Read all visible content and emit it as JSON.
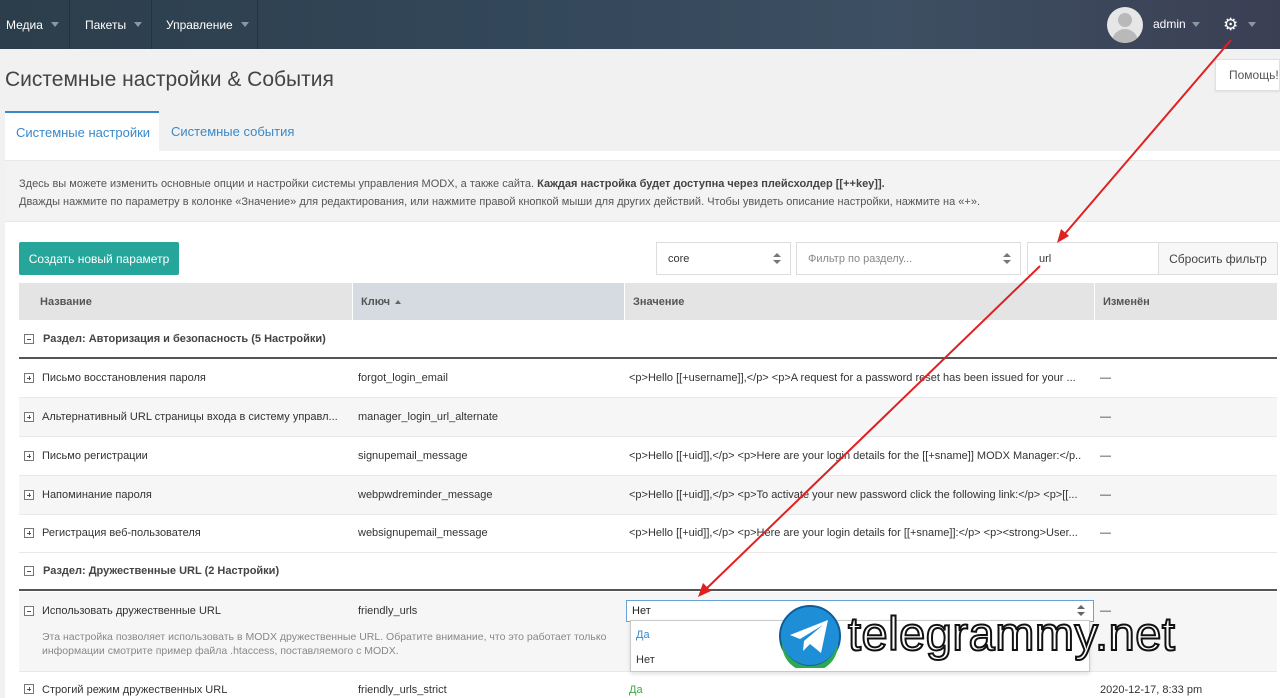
{
  "topnav": {
    "items": [
      {
        "label": "Медиа"
      },
      {
        "label": "Пакеты"
      },
      {
        "label": "Управление"
      }
    ],
    "user": "admin"
  },
  "help_button": "Помощь!",
  "page_title": "Системные настройки & События",
  "tabs": [
    {
      "label": "Системные настройки"
    },
    {
      "label": "Системные события"
    }
  ],
  "description": {
    "line1_plain": "Здесь вы можете изменить основные опции и настройки системы управления MODX, а также сайта.",
    "line1_bold": "Каждая настройка будет доступна через плейсхолдер [[++key]].",
    "line2": "Дважды нажмите по параметру в колонке «Значение» для редактирования, или нажмите правой кнопкой мыши для других действий. Чтобы увидеть описание настройки, нажмите на «+»."
  },
  "toolbar": {
    "create_label": "Создать новый параметр",
    "namespace_value": "core",
    "area_placeholder": "Фильтр по разделу...",
    "search_value": "url",
    "reset_label": "Сбросить фильтр"
  },
  "grid": {
    "columns": [
      "Название",
      "Ключ",
      "Значение",
      "Изменён"
    ],
    "group1": "Раздел: Авторизация и безопасность (5 Настройки)",
    "group2": "Раздел: Дружественные URL (2 Настройки)",
    "rows": [
      {
        "name": "Письмо восстановления пароля",
        "key": "forgot_login_email",
        "value": "<p>Hello [[+username]],</p> <p>A request for a password reset has been issued for your ...",
        "modified": "—"
      },
      {
        "name": "Альтернативный URL страницы входа в систему управл...",
        "key": "manager_login_url_alternate",
        "value": "",
        "modified": "—"
      },
      {
        "name": "Письмо регистрации",
        "key": "signupemail_message",
        "value": "<p>Hello [[+uid]],</p> <p>Here are your login details for the [[+sname]] MODX Manager:</p...",
        "modified": "—"
      },
      {
        "name": "Напоминание пароля",
        "key": "webpwdreminder_message",
        "value": "<p>Hello [[+uid]],</p> <p>To activate your new password click the following link:</p> <p>[[...",
        "modified": "—"
      },
      {
        "name": "Регистрация веб-пользователя",
        "key": "websignupemail_message",
        "value": "<p>Hello [[+uid]],</p> <p>Here are your login details for [[+sname]]:</p> <p><strong>User...",
        "modified": "—"
      }
    ],
    "expanded_row": {
      "name": "Использовать дружественные URL",
      "key": "friendly_urls",
      "modified": "—",
      "desc_line1": "Эта настройка позволяет использовать в MODX дружественные URL. Обратите внимание, что это работает только",
      "desc_line2": "информации смотрите пример файла .htaccess, поставляемого с MODX.",
      "edit_value": "Нет",
      "options": [
        "Да",
        "Нет"
      ]
    },
    "last_row": {
      "name": "Строгий режим дружественных URL",
      "key": "friendly_urls_strict",
      "value": "Да",
      "modified": "2020-12-17, 8:33 pm"
    }
  },
  "watermark": "telegrammy.net",
  "colors": {
    "accent": "#3a89c9",
    "create_button": "#26a69a",
    "annotation": "#e02020",
    "green_value": "#3aa845"
  }
}
